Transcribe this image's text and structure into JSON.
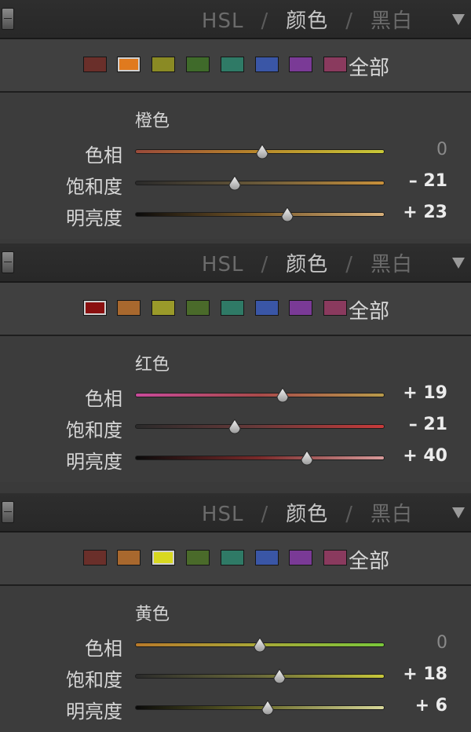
{
  "panels": [
    {
      "header": {
        "tab_hsl": "HSL",
        "sep1": "/",
        "tab_color": "颜色",
        "sep2": "/",
        "tab_bw": "黑白"
      },
      "all_label": "全部",
      "swatches": [
        "#6a2f2a",
        "#e07a1e",
        "#8a8a24",
        "#3f6a2a",
        "#2f7a66",
        "#3a56a6",
        "#7a3a96",
        "#8a3a5e"
      ],
      "selected_swatch": 1,
      "color_name": "橙色",
      "sliders": [
        {
          "label": "色相",
          "value": "0",
          "position": 0.51,
          "colors": [
            "#9a4a3a",
            "#b8882a",
            "#c8c838"
          ]
        },
        {
          "label": "饱和度",
          "value": "– 21",
          "position": 0.4,
          "colors": [
            "#2a2a2a",
            "#6a5a3a",
            "#c8903a"
          ]
        },
        {
          "label": "明亮度",
          "value": "+ 23",
          "position": 0.61,
          "colors": [
            "#0a0a0a",
            "#7a5a2a",
            "#d8b07a"
          ]
        }
      ]
    },
    {
      "header": {
        "tab_hsl": "HSL",
        "sep1": "/",
        "tab_color": "颜色",
        "sep2": "/",
        "tab_bw": "黑白"
      },
      "all_label": "全部",
      "swatches": [
        "#8a1010",
        "#a8682e",
        "#9a9a2a",
        "#4a6a2a",
        "#2f7a66",
        "#3a56a6",
        "#7a3a96",
        "#8a3a5e"
      ],
      "selected_swatch": 0,
      "color_name": "红色",
      "sliders": [
        {
          "label": "色相",
          "value": "+ 19",
          "position": 0.59,
          "colors": [
            "#c84a9a",
            "#a84a4a",
            "#b89a4a"
          ]
        },
        {
          "label": "饱和度",
          "value": "– 21",
          "position": 0.4,
          "colors": [
            "#2a2a2a",
            "#6a3a3a",
            "#c83a3a"
          ]
        },
        {
          "label": "明亮度",
          "value": "+ 40",
          "position": 0.69,
          "colors": [
            "#0a0a0a",
            "#7a2a2a",
            "#d89a9a"
          ]
        }
      ]
    },
    {
      "header": {
        "tab_hsl": "HSL",
        "sep1": "/",
        "tab_color": "颜色",
        "sep2": "/",
        "tab_bw": "黑白"
      },
      "all_label": "全部",
      "swatches": [
        "#6a2f2a",
        "#a8682e",
        "#d8d820",
        "#4a6a2a",
        "#2f7a66",
        "#3a56a6",
        "#7a3a96",
        "#8a3a5e"
      ],
      "selected_swatch": 2,
      "color_name": "黄色",
      "sliders": [
        {
          "label": "色相",
          "value": "0",
          "position": 0.5,
          "colors": [
            "#b87a2a",
            "#a8a838",
            "#7ac83a"
          ]
        },
        {
          "label": "饱和度",
          "value": "+ 18",
          "position": 0.58,
          "colors": [
            "#2a2a2a",
            "#6a6a3a",
            "#c8c83a"
          ]
        },
        {
          "label": "明亮度",
          "value": "+ 6",
          "position": 0.53,
          "colors": [
            "#0a0a0a",
            "#6a6a2a",
            "#d8d89a"
          ]
        }
      ]
    }
  ]
}
